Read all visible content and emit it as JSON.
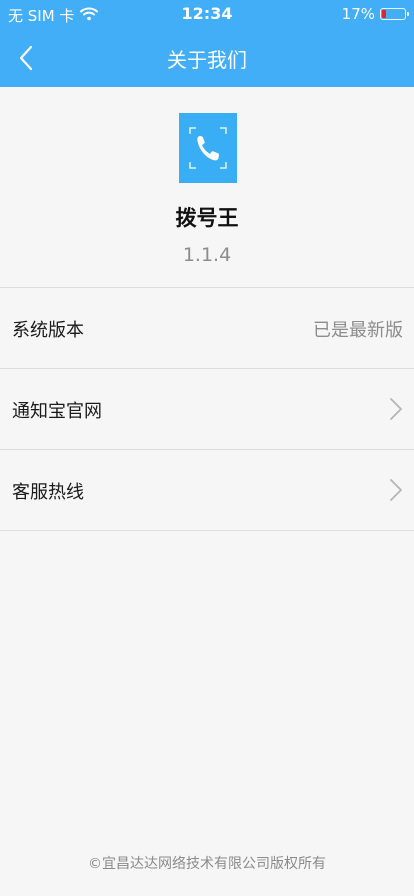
{
  "status_bar": {
    "carrier": "无 SIM 卡",
    "time": "12:34",
    "battery_percent": "17%",
    "battery_level": 0.17,
    "wifi_icon": "wifi-icon"
  },
  "nav": {
    "title": "关于我们",
    "back_icon": "chevron-left-icon"
  },
  "app": {
    "icon": "phone-icon",
    "name": "拨号王",
    "version": "1.1.4"
  },
  "list": {
    "items": [
      {
        "label": "系统版本",
        "value": "已是最新版"
      },
      {
        "label": "通知宝官网",
        "icon": "chevron-right-icon"
      },
      {
        "label": "客服热线",
        "icon": "chevron-right-icon"
      }
    ]
  },
  "footer": {
    "copyright": "©宜昌达达网络技术有限公司版权所有"
  },
  "colors": {
    "accent": "#42aef7",
    "background": "#f6f6f6",
    "battery_low": "#e0242a"
  }
}
